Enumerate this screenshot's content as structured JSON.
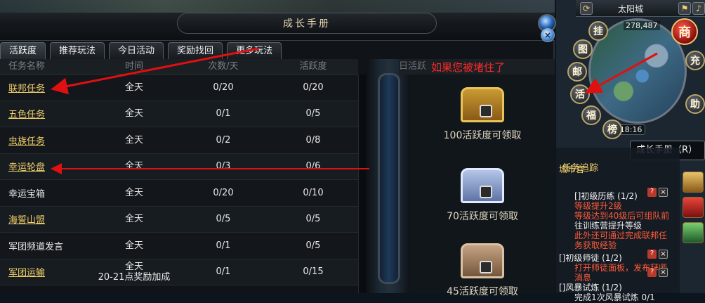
{
  "window": {
    "title": "成长手册",
    "close_icon": "×"
  },
  "tabs": [
    {
      "label": "活跃度",
      "active": true
    },
    {
      "label": "推荐玩法",
      "active": false
    },
    {
      "label": "今日活动",
      "active": false
    },
    {
      "label": "奖励找回",
      "active": false
    },
    {
      "label": "更多玩法",
      "active": false
    }
  ],
  "table": {
    "headers": [
      "任务名称",
      "时间",
      "次数/天",
      "活跃度"
    ],
    "rows": [
      {
        "name": "联邦任务",
        "link": true,
        "time": "全天",
        "count": "0/20",
        "activity": "0/20"
      },
      {
        "name": "五色任务",
        "link": true,
        "time": "全天",
        "count": "0/1",
        "activity": "0/5"
      },
      {
        "name": "虫族任务",
        "link": true,
        "time": "全天",
        "count": "0/2",
        "activity": "0/8"
      },
      {
        "name": "幸运轮盘",
        "link": true,
        "time": "全天",
        "count": "0/3",
        "activity": "0/6"
      },
      {
        "name": "幸运宝箱",
        "link": false,
        "time": "全天",
        "count": "0/20",
        "activity": "0/10"
      },
      {
        "name": "海誓山盟",
        "link": true,
        "time": "全天",
        "count": "0/5",
        "activity": "0/5"
      },
      {
        "name": "军团频道发言",
        "link": false,
        "time": "全天",
        "count": "0/1",
        "activity": "0/5"
      },
      {
        "name": "军团运输",
        "link": true,
        "time": "全天",
        "time2": "20-21点奖励加成",
        "count": "0/1",
        "activity": "0/15"
      }
    ]
  },
  "rewards": {
    "header": "日活跃",
    "hint": "如果您被堵住了",
    "chests": [
      {
        "label": "100活跃度可领取",
        "type": "gold"
      },
      {
        "label": "70活跃度可领取",
        "type": "silver"
      },
      {
        "label": "45活跃度可领取",
        "type": "bronze"
      }
    ]
  },
  "hud": {
    "map_name": "太阳城",
    "coords": "278,487",
    "clock": "16:18:16",
    "buttons": {
      "shop": "商",
      "hang": "挂",
      "map": "图",
      "mail": "邮",
      "activity": "活",
      "welfare": "福",
      "charge": "充",
      "ranking": "榜",
      "assist": "助"
    },
    "tooltip": "成长手册（R）",
    "tracker": {
      "title": "任务追踪",
      "lines": [
        {
          "text": "城市官",
          "color": "#f2d06a"
        },
        {
          "text": "[]初级历练 (1/2)",
          "color": "#eaeaea"
        },
        {
          "text": "等级提升2级",
          "color": "#ff5a3a"
        },
        {
          "text": "等级达到40级后可组队前",
          "color": "#ff5a3a"
        },
        {
          "text": "往训练营提升等级",
          "color": "#eaeaea"
        },
        {
          "text": "此外还可通过完成联邦任",
          "color": "#ff5a3a"
        },
        {
          "text": "务获取经验",
          "color": "#ff5a3a"
        },
        {
          "text": "[]初级师徒 (1/2)",
          "color": "#eaeaea"
        },
        {
          "text": "打开师徒面板，发布拜师",
          "color": "#ff5a3a"
        },
        {
          "text": "消息",
          "color": "#ff5a3a"
        },
        {
          "text": "[]风暴试炼 (1/2)",
          "color": "#eaeaea"
        },
        {
          "text": "完成1次风暴试炼 0/1",
          "color": "#eaeaea"
        }
      ]
    }
  },
  "colors": {
    "annotation": "#e01010",
    "link_gold": "#f2d06a"
  }
}
